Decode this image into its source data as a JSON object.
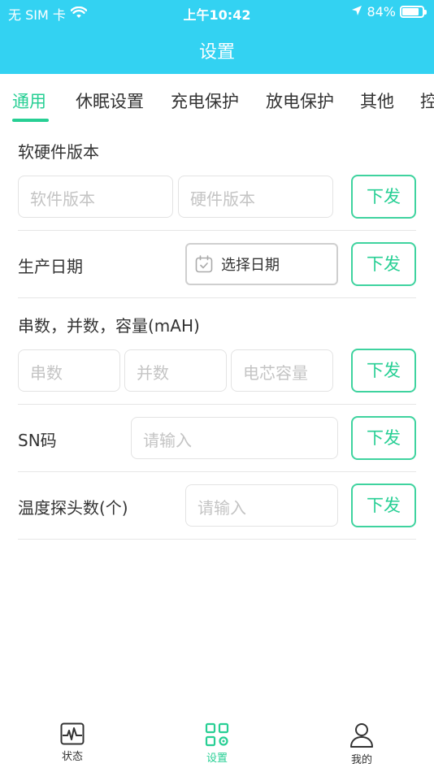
{
  "status_bar": {
    "carrier": "无 SIM 卡",
    "time": "上午10:42",
    "battery_percent": "84%",
    "battery_level": 0.84
  },
  "nav": {
    "title": "设置"
  },
  "tabs": [
    {
      "label": "通用",
      "active": true
    },
    {
      "label": "休眠设置",
      "active": false
    },
    {
      "label": "充电保护",
      "active": false
    },
    {
      "label": "放电保护",
      "active": false
    },
    {
      "label": "其他",
      "active": false
    },
    {
      "label": "控",
      "active": false
    }
  ],
  "sections": {
    "version": {
      "label": "软硬件版本",
      "software_placeholder": "软件版本",
      "hardware_placeholder": "硬件版本",
      "button": "下发"
    },
    "production_date": {
      "label": "生产日期",
      "date_value": "选择日期",
      "button": "下发"
    },
    "cells": {
      "label": "串数，并数，容量(mAH)",
      "series_placeholder": "串数",
      "parallel_placeholder": "并数",
      "capacity_placeholder": "电芯容量",
      "button": "下发"
    },
    "sn": {
      "label": "SN码",
      "placeholder": "请输入",
      "button": "下发"
    },
    "temp_probe": {
      "label": "温度探头数(个)",
      "placeholder": "请输入",
      "button": "下发"
    }
  },
  "tabbar": [
    {
      "label": "状态",
      "icon": "pulse-monitor-icon",
      "active": false
    },
    {
      "label": "设置",
      "icon": "settings-grid-icon",
      "active": true
    },
    {
      "label": "我的",
      "icon": "user-icon",
      "active": false
    }
  ],
  "colors": {
    "header_bg": "#33d2f2",
    "accent": "#27cf94"
  }
}
